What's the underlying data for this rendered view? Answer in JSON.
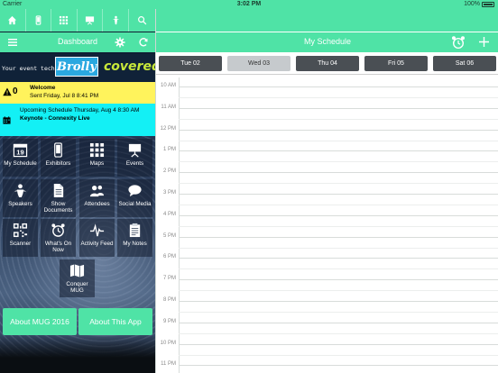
{
  "status_bar": {
    "carrier": "Carrier",
    "time": "3:02 PM",
    "battery": "100%"
  },
  "left_nav": {
    "icons": [
      "home-icon",
      "phone-icon",
      "grid-icon",
      "presentation-icon",
      "figure-icon",
      "search-icon"
    ]
  },
  "dashboard": {
    "title": "Dashboard"
  },
  "banner": {
    "tagline": "Your event tech.",
    "logo": "Brolly",
    "slogan": "covered"
  },
  "alerts": {
    "welcome": {
      "count": "0",
      "title": "Welcome",
      "subtitle": "Sent Friday, Jul 8 8:41 PM"
    },
    "upcoming": {
      "title": "Upcoming Schedule Thursday, Aug 4 8:30 AM",
      "subtitle": "Keynote - Connexity Live"
    }
  },
  "tiles": [
    {
      "label": "My Schedule",
      "icon": "calendar-icon"
    },
    {
      "label": "Exhibitors",
      "icon": "phone-icon"
    },
    {
      "label": "Maps",
      "icon": "grid-icon"
    },
    {
      "label": "Events",
      "icon": "presentation-icon"
    },
    {
      "label": "Speakers",
      "icon": "speaker-icon"
    },
    {
      "label": "Show Documents",
      "icon": "document-icon"
    },
    {
      "label": "Attendees",
      "icon": "people-icon"
    },
    {
      "label": "Social Media",
      "icon": "chat-bubble-icon"
    },
    {
      "label": "Scanner",
      "icon": "qr-code-icon"
    },
    {
      "label": "What's On Now",
      "icon": "alarm-clock-icon"
    },
    {
      "label": "Activity Feed",
      "icon": "pulse-icon"
    },
    {
      "label": "My Notes",
      "icon": "clipboard-icon"
    },
    {
      "label": "Conquer MUG",
      "icon": "map-icon"
    }
  ],
  "about": {
    "mug": "About MUG 2016",
    "app": "About This App"
  },
  "schedule": {
    "title": "My Schedule",
    "days": [
      {
        "label": "Tue 02",
        "active": false
      },
      {
        "label": "Wed 03",
        "active": true
      },
      {
        "label": "Thu 04",
        "active": false
      },
      {
        "label": "Fri 05",
        "active": false
      },
      {
        "label": "Sat 06",
        "active": false
      }
    ],
    "hours": [
      "10 AM",
      "11 AM",
      "12 PM",
      "1 PM",
      "2 PM",
      "3 PM",
      "4 PM",
      "5 PM",
      "6 PM",
      "7 PM",
      "8 PM",
      "9 PM",
      "10 PM",
      "11 PM"
    ]
  },
  "colors": {
    "accent": "#4fe3a6",
    "welcome_bg": "#fff35c",
    "upcoming_bg": "#13f0f5",
    "day_tab": "#4a4f54",
    "day_tab_active": "#c6cacd"
  }
}
